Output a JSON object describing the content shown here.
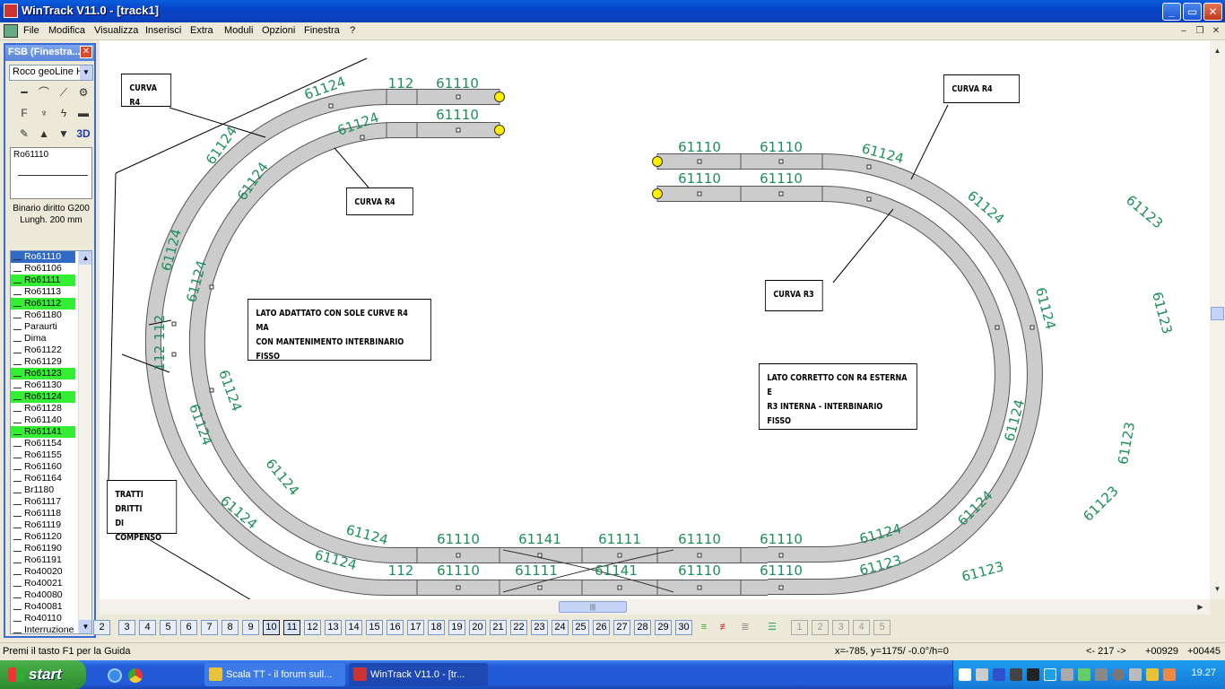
{
  "window": {
    "title": "WinTrack  V11.0 - [track1]",
    "minimize": "_",
    "maximize": "▭",
    "close": "✕"
  },
  "menu": [
    "File",
    "Modifica",
    "Visualizza",
    "Inserisci",
    "Extra",
    "Moduli",
    "Opzioni",
    "Finestra",
    "?"
  ],
  "mdi_controls": {
    "minimize": "–",
    "restore": "❐",
    "close": "✕"
  },
  "fsb": {
    "title": "FSB (Finestra...",
    "close": "✕",
    "combo_value": "Roco geoLine H",
    "tool_icons": [
      "straight-track-icon",
      "curve-track-icon",
      "turnout-icon",
      "turntable-icon",
      "signal-icon",
      "semaphore-icon",
      "electrification-icon",
      "buffer-icon",
      "accessory-icon",
      "raise-icon",
      "lower-icon",
      "view-3d-icon"
    ],
    "label_3d": "3D",
    "preview_code": "Ro61110",
    "description_line1": "Binario diritto G200",
    "description_line2": "Lungh. 200 mm",
    "list": [
      {
        "t": "Ro61110",
        "s": "sel"
      },
      {
        "t": "Ro61106",
        "s": ""
      },
      {
        "t": "Ro61111",
        "s": "hl"
      },
      {
        "t": "Ro61113",
        "s": ""
      },
      {
        "t": "Ro61112",
        "s": "hl"
      },
      {
        "t": "Ro61180",
        "s": ""
      },
      {
        "t": "Paraurti",
        "s": ""
      },
      {
        "t": "Dima",
        "s": ""
      },
      {
        "t": "Ro61122",
        "s": ""
      },
      {
        "t": "Ro61129",
        "s": ""
      },
      {
        "t": "Ro61123",
        "s": "hl"
      },
      {
        "t": "Ro61130",
        "s": ""
      },
      {
        "t": "Ro61124",
        "s": "hl"
      },
      {
        "t": "Ro61128",
        "s": ""
      },
      {
        "t": "Ro61140",
        "s": ""
      },
      {
        "t": "Ro61141",
        "s": "hl"
      },
      {
        "t": "Ro61154",
        "s": ""
      },
      {
        "t": "Ro61155",
        "s": ""
      },
      {
        "t": "Ro61160",
        "s": ""
      },
      {
        "t": "Ro61164",
        "s": ""
      },
      {
        "t": "Br1180",
        "s": ""
      },
      {
        "t": "Ro61117",
        "s": ""
      },
      {
        "t": "Ro61118",
        "s": ""
      },
      {
        "t": "Ro61119",
        "s": ""
      },
      {
        "t": "Ro61120",
        "s": ""
      },
      {
        "t": "Ro61190",
        "s": ""
      },
      {
        "t": "Ro61191",
        "s": ""
      },
      {
        "t": "Ro40020",
        "s": ""
      },
      {
        "t": "Ro40021",
        "s": ""
      },
      {
        "t": "Ro40080",
        "s": ""
      },
      {
        "t": "Ro40081",
        "s": ""
      },
      {
        "t": "Ro40110",
        "s": ""
      },
      {
        "t": "Interruzione",
        "s": ""
      }
    ]
  },
  "annotations": [
    {
      "id": "curva-r4-top-left",
      "text": "CURVA R4"
    },
    {
      "id": "curva-r4-inner-left",
      "text": "CURVA R4"
    },
    {
      "id": "curva-r4-right",
      "text": "CURVA R4"
    },
    {
      "id": "curva-r3-right",
      "text": "CURVA R3"
    },
    {
      "id": "note-left-side",
      "text": "LATO ADATTATO CON SOLE CURVE R4 MA\nCON MANTENIMENTO INTERBINARIO FISSO"
    },
    {
      "id": "note-right-side",
      "text": "LATO CORRETTO CON R4 ESTERNA E\nR3 INTERNA - INTERBINARIO FISSO"
    },
    {
      "id": "note-compensation",
      "text": "TRATTI DRITTI\nDI COMPENSO"
    }
  ],
  "track_labels": {
    "straight": [
      {
        "t": "112"
      },
      {
        "t": "61110"
      },
      {
        "t": "61110"
      },
      {
        "t": "61110"
      },
      {
        "t": "61110"
      },
      {
        "t": "61110"
      },
      {
        "t": "61110"
      },
      {
        "t": "61110"
      },
      {
        "t": "61141"
      },
      {
        "t": "61111"
      },
      {
        "t": "61110"
      },
      {
        "t": "61110"
      },
      {
        "t": "112"
      },
      {
        "t": "61110"
      },
      {
        "t": "61111"
      },
      {
        "t": "61141"
      },
      {
        "t": "61110"
      },
      {
        "t": "61110"
      }
    ],
    "curves": [
      {
        "t": "61124"
      },
      {
        "t": "61124"
      },
      {
        "t": "61124"
      },
      {
        "t": "61124"
      },
      {
        "t": "61124"
      },
      {
        "t": "61124"
      },
      {
        "t": "61124"
      },
      {
        "t": "61124"
      },
      {
        "t": "61124"
      },
      {
        "t": "61124"
      },
      {
        "t": "61124"
      },
      {
        "t": "61124"
      },
      {
        "t": "61124"
      },
      {
        "t": "61124"
      },
      {
        "t": "61124"
      },
      {
        "t": "61124"
      },
      {
        "t": "61124"
      },
      {
        "t": "61124"
      },
      {
        "t": "61123"
      },
      {
        "t": "61123"
      },
      {
        "t": "61123"
      },
      {
        "t": "61123"
      },
      {
        "t": "61123"
      },
      {
        "t": "61123"
      }
    ],
    "vertical": [
      {
        "t": "112"
      },
      {
        "t": "112"
      }
    ]
  },
  "layer_buttons": [
    "2",
    "3",
    "4",
    "5",
    "6",
    "7",
    "8",
    "9",
    "10",
    "11",
    "12",
    "13",
    "14",
    "15",
    "16",
    "17",
    "18",
    "19",
    "20",
    "21",
    "22",
    "23",
    "24",
    "25",
    "26",
    "27",
    "28",
    "29",
    "30"
  ],
  "toolbar_icons": [
    "layers-icon",
    "layer-edit-icon",
    "layer-hide-icon",
    "layer-manager-icon"
  ],
  "view_buttons": [
    "1",
    "2",
    "3",
    "4",
    "5"
  ],
  "status": {
    "help": "Premi il tasto F1 per la Guida",
    "coords": "x=-785, y=1175/ -0.0°/h=0",
    "counter": "<- 217 ->",
    "pos_x": "+00929",
    "pos_y": "+00445"
  },
  "taskbar": {
    "start": "start",
    "tasks": [
      {
        "label": "Scala TT - il forum sull...",
        "active": false
      },
      {
        "label": "WinTrack  V11.0 - [tr...",
        "active": true
      }
    ],
    "clock": "19.27"
  },
  "colors": {
    "track_fill": "#cccccc",
    "track_stroke": "#555555",
    "label_green": "#1d8f5a",
    "end_marker": "#ffee00",
    "highlight": "#33ee33",
    "selection": "#316ac5"
  }
}
